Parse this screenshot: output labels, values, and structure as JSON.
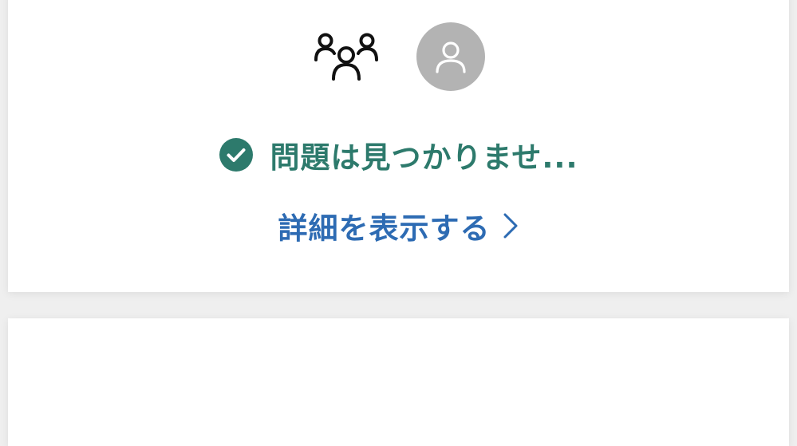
{
  "status": {
    "text": "問題は見つかりませ..."
  },
  "details": {
    "label": "詳細を表示する"
  },
  "icons": {
    "group": "group-icon",
    "avatar": "user-avatar-icon",
    "check": "check-circle-icon",
    "chevron": "chevron-right-icon"
  },
  "colors": {
    "status_green": "#2d7a6c",
    "link_blue": "#2d6bb3",
    "avatar_gray": "#b3b3b3",
    "background": "#efefef"
  }
}
